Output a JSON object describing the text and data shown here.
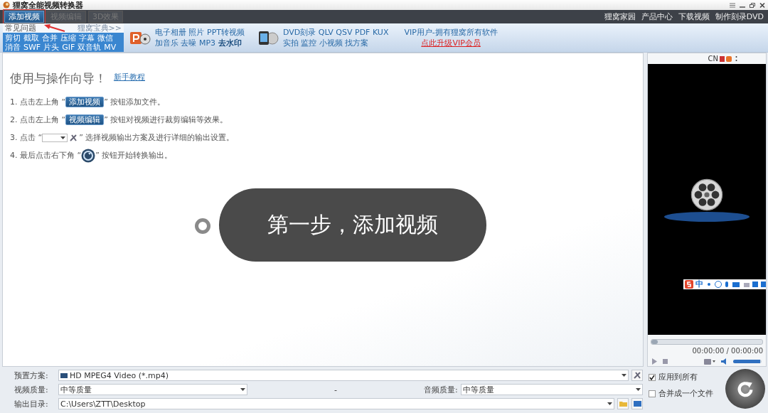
{
  "window": {
    "title": "狸窝全能视频转换器"
  },
  "toolbar": {
    "tabs": [
      {
        "label": "添加视频",
        "selected": true
      },
      {
        "label": "视频编辑",
        "selected": false
      },
      {
        "label": "3D效果",
        "selected": false
      }
    ],
    "links": [
      "狸窝家园",
      "产品中心",
      "下载视频",
      "制作刻录DVD"
    ]
  },
  "promo": {
    "faq_title": "常见问题",
    "faq_more": "狸窝宝典>>",
    "faq_rows": [
      [
        "剪切",
        "截取",
        "合并",
        "压缩",
        "字幕",
        "微信"
      ],
      [
        "消音",
        "SWF",
        "片头",
        "GIF",
        "双音轨",
        "MV"
      ]
    ],
    "groups": [
      {
        "kind": "ppt",
        "lines": [
          "电子相册 照片 PPT转视频",
          "加音乐 去噪 MP3 **去水印**"
        ]
      },
      {
        "kind": "dvd",
        "lines": [
          "DVD刻录 QLV QSV PDF KUX",
          "实拍 监控 小视频 找方案"
        ]
      }
    ],
    "vip_text": "VIP用户-拥有狸窝所有软件",
    "vip_link": "点此升级VIP会员"
  },
  "guide": {
    "title": "使用与操作向导！",
    "tutorial_link": "新手教程",
    "steps": [
      {
        "kind": "button",
        "prefix": "1. 点击左上角 “",
        "button": "添加视频",
        "suffix": "” 按钮添加文件。"
      },
      {
        "kind": "button",
        "prefix": "2. 点击左上角 “",
        "button": "视频编辑",
        "suffix": "” 按钮对视频进行裁剪编辑等效果。"
      },
      {
        "kind": "dropdown",
        "prefix": "3. 点击 “",
        "suffix": "” 选择视频输出方案及进行详细的输出设置。"
      },
      {
        "kind": "convert",
        "prefix": "4. 最后点击右下角 “",
        "suffix": "” 按钮开始转换输出。"
      }
    ]
  },
  "callout": "第一步，添加视频",
  "preview": {
    "lang": "CN",
    "ime_lang": "中",
    "seek": {
      "level": 0
    },
    "time": "00:00:00 / 00:00:00",
    "volume": {
      "level": 0.95
    }
  },
  "settings": {
    "preset_label": "预置方案:",
    "preset_value": "HD MPEG4 Video (*.mp4)",
    "video_quality_label": "视频质量:",
    "video_quality": "中等质量",
    "separator": "-",
    "audio_quality_label": "音频质量:",
    "audio_quality": "中等质量",
    "output_label": "输出目录:",
    "output_path": "C:\\Users\\ZTT\\Desktop",
    "options": [
      {
        "label": "应用到所有",
        "checked": true
      },
      {
        "label": "合并成一个文件",
        "checked": false
      }
    ]
  }
}
